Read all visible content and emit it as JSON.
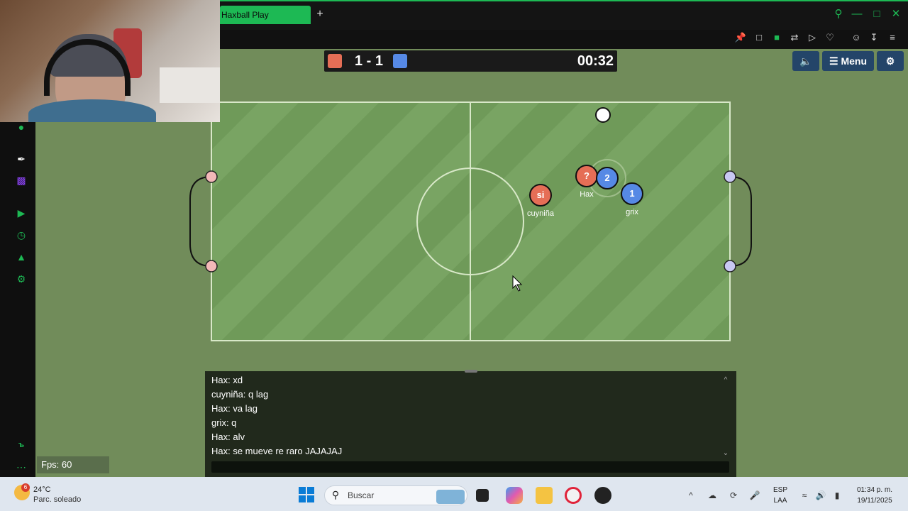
{
  "browser": {
    "tab_title": "Haxball Play",
    "new_tab": "+",
    "colors": {
      "accent": "#1db954",
      "chrome": "#141414"
    }
  },
  "game": {
    "red_score": "1 - 1",
    "timer": "00:32",
    "menu_label": "Menu",
    "red_color": "#e56e56",
    "blue_color": "#5689e5",
    "players": [
      {
        "avatar": "si",
        "name": "cuyniña",
        "team": "red"
      },
      {
        "avatar": "?",
        "name": "Hax",
        "team": "red"
      },
      {
        "avatar": "2",
        "name": "",
        "team": "blue"
      },
      {
        "avatar": "1",
        "name": "grix",
        "team": "blue"
      }
    ]
  },
  "chat": {
    "messages": [
      "Hax: xd",
      "cuyniña: q lag",
      "Hax: va lag",
      "grix: q",
      "Hax: alv",
      "Hax: se mueve re raro JAJAJAJ"
    ]
  },
  "fps": "Fps: 60",
  "taskbar": {
    "weather_badge": "6",
    "temperature": "24°C",
    "weather_desc": "Parc. soleado",
    "search_placeholder": "Buscar",
    "lang_line1": "ESP",
    "lang_line2": "LAA",
    "time": "01:34 p. m.",
    "date": "19/11/2025"
  }
}
